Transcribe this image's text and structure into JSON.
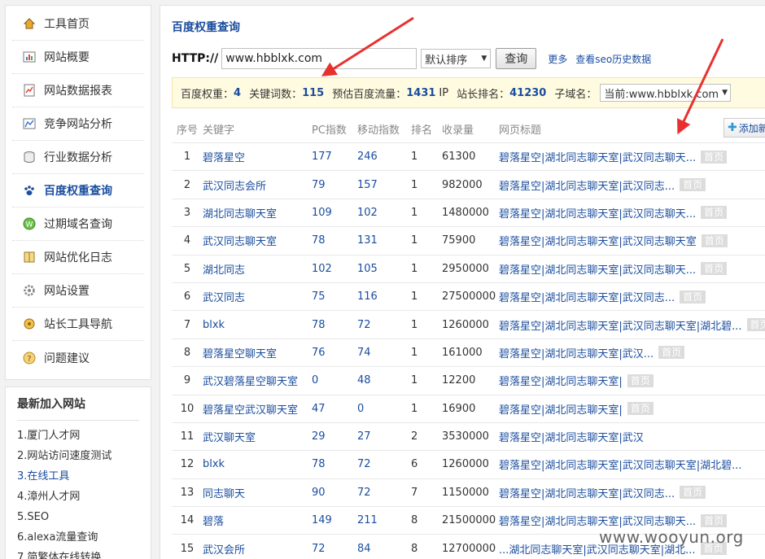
{
  "sidebar": {
    "items": [
      {
        "label": "工具首页",
        "icon": "home-icon"
      },
      {
        "label": "网站概要",
        "icon": "chart-icon"
      },
      {
        "label": "网站数据报表",
        "icon": "report-icon"
      },
      {
        "label": "竞争网站分析",
        "icon": "compare-icon"
      },
      {
        "label": "行业数据分析",
        "icon": "database-icon"
      },
      {
        "label": "百度权重查询",
        "icon": "paw-icon",
        "active": true
      },
      {
        "label": "过期域名查询",
        "icon": "domain-icon"
      },
      {
        "label": "网站优化日志",
        "icon": "book-icon"
      },
      {
        "label": "网站设置",
        "icon": "gear-icon"
      },
      {
        "label": "站长工具导航",
        "icon": "compass-icon"
      },
      {
        "label": "问题建议",
        "icon": "question-icon"
      }
    ],
    "recent": {
      "title": "最新加入网站",
      "items": [
        "1.厦门人才网",
        "2.网站访问速度测试",
        "3.在线工具",
        "4.漳州人才网",
        "5.SEO",
        "6.alexa流量查询",
        "7.简繁体在线转换"
      ]
    }
  },
  "main": {
    "title": "百度权重查询",
    "http_label": "HTTP://",
    "domain": "www.hbblxk.com",
    "sort": "默认排序",
    "query_button": "查询",
    "more": "更多",
    "history": "查看seo历史数据",
    "stats": {
      "weight_label": "百度权重：",
      "weight": "4",
      "keywords_label": "关键词数：",
      "keywords": "115",
      "traffic_label": "预估百度流量：",
      "traffic": "1431",
      "traffic_unit": "IP",
      "rank_label": "站长排名：",
      "rank": "41230",
      "subdomain_label": "子域名：",
      "subdomain": "当前:www.hbblxk.com"
    },
    "add_button": "添加新",
    "columns": [
      "序号",
      "关键字",
      "PC指数",
      "移动指数",
      "排名",
      "收录量",
      "网页标题"
    ],
    "rows": [
      {
        "idx": "1",
        "kw": "碧落星空",
        "pc": "177",
        "mob": "246",
        "rank": "1",
        "inc": "61300",
        "title": "碧落星空|湖北同志聊天室|武汉同志聊天...",
        "tag": "首页"
      },
      {
        "idx": "2",
        "kw": "武汉同志会所",
        "pc": "79",
        "mob": "157",
        "rank": "1",
        "inc": "982000",
        "title": "碧落星空|湖北同志聊天室|武汉同志...",
        "tag": "首页"
      },
      {
        "idx": "3",
        "kw": "湖北同志聊天室",
        "pc": "109",
        "mob": "102",
        "rank": "1",
        "inc": "1480000",
        "title": "碧落星空|湖北同志聊天室|武汉同志聊天...",
        "tag": "首页"
      },
      {
        "idx": "4",
        "kw": "武汉同志聊天室",
        "pc": "78",
        "mob": "131",
        "rank": "1",
        "inc": "75900",
        "title": "碧落星空|湖北同志聊天室|武汉同志聊天室",
        "tag": "首页"
      },
      {
        "idx": "5",
        "kw": "湖北同志",
        "pc": "102",
        "mob": "105",
        "rank": "1",
        "inc": "2950000",
        "title": "碧落星空|湖北同志聊天室|武汉同志聊天...",
        "tag": "首页"
      },
      {
        "idx": "6",
        "kw": "武汉同志",
        "pc": "75",
        "mob": "116",
        "rank": "1",
        "inc": "27500000",
        "title": "碧落星空|湖北同志聊天室|武汉同志...",
        "tag": "首页"
      },
      {
        "idx": "7",
        "kw": "blxk",
        "pc": "78",
        "mob": "72",
        "rank": "1",
        "inc": "1260000",
        "title": "碧落星空|湖北同志聊天室|武汉同志聊天室|湖北碧...",
        "tag": "首页"
      },
      {
        "idx": "8",
        "kw": "碧落星空聊天室",
        "pc": "76",
        "mob": "74",
        "rank": "1",
        "inc": "161000",
        "title": "碧落星空|湖北同志聊天室|武汉...",
        "tag": "首页"
      },
      {
        "idx": "9",
        "kw": "武汉碧落星空聊天室",
        "pc": "0",
        "mob": "48",
        "rank": "1",
        "inc": "12200",
        "title": "碧落星空|湖北同志聊天室|",
        "tag": "首页"
      },
      {
        "idx": "10",
        "kw": "碧落星空武汉聊天室",
        "pc": "47",
        "mob": "0",
        "rank": "1",
        "inc": "16900",
        "title": "碧落星空|湖北同志聊天室|",
        "tag": "首页"
      },
      {
        "idx": "11",
        "kw": "武汉聊天室",
        "pc": "29",
        "mob": "27",
        "rank": "2",
        "inc": "3530000",
        "title": "碧落星空|湖北同志聊天室|武汉",
        "tag": ""
      },
      {
        "idx": "12",
        "kw": "blxk",
        "pc": "78",
        "mob": "72",
        "rank": "6",
        "inc": "1260000",
        "title": "碧落星空|湖北同志聊天室|武汉同志聊天室|湖北碧...",
        "tag": ""
      },
      {
        "idx": "13",
        "kw": "同志聊天",
        "pc": "90",
        "mob": "72",
        "rank": "7",
        "inc": "1150000",
        "title": "碧落星空|湖北同志聊天室|武汉同志...",
        "tag": "首页"
      },
      {
        "idx": "14",
        "kw": "碧落",
        "pc": "149",
        "mob": "211",
        "rank": "8",
        "inc": "21500000",
        "title": "碧落星空|湖北同志聊天室|武汉同志聊天...",
        "tag": "首页"
      },
      {
        "idx": "15",
        "kw": "武汉会所",
        "pc": "72",
        "mob": "84",
        "rank": "8",
        "inc": "12700000",
        "title": "...湖北同志聊天室|武汉同志聊天室|湖北...",
        "tag": "首页"
      }
    ]
  },
  "watermark": "www.wooyun.org",
  "colors": {
    "link": "#1a4d9e",
    "arrow": "#e8312f",
    "stats_bg": "#fffbe0"
  }
}
